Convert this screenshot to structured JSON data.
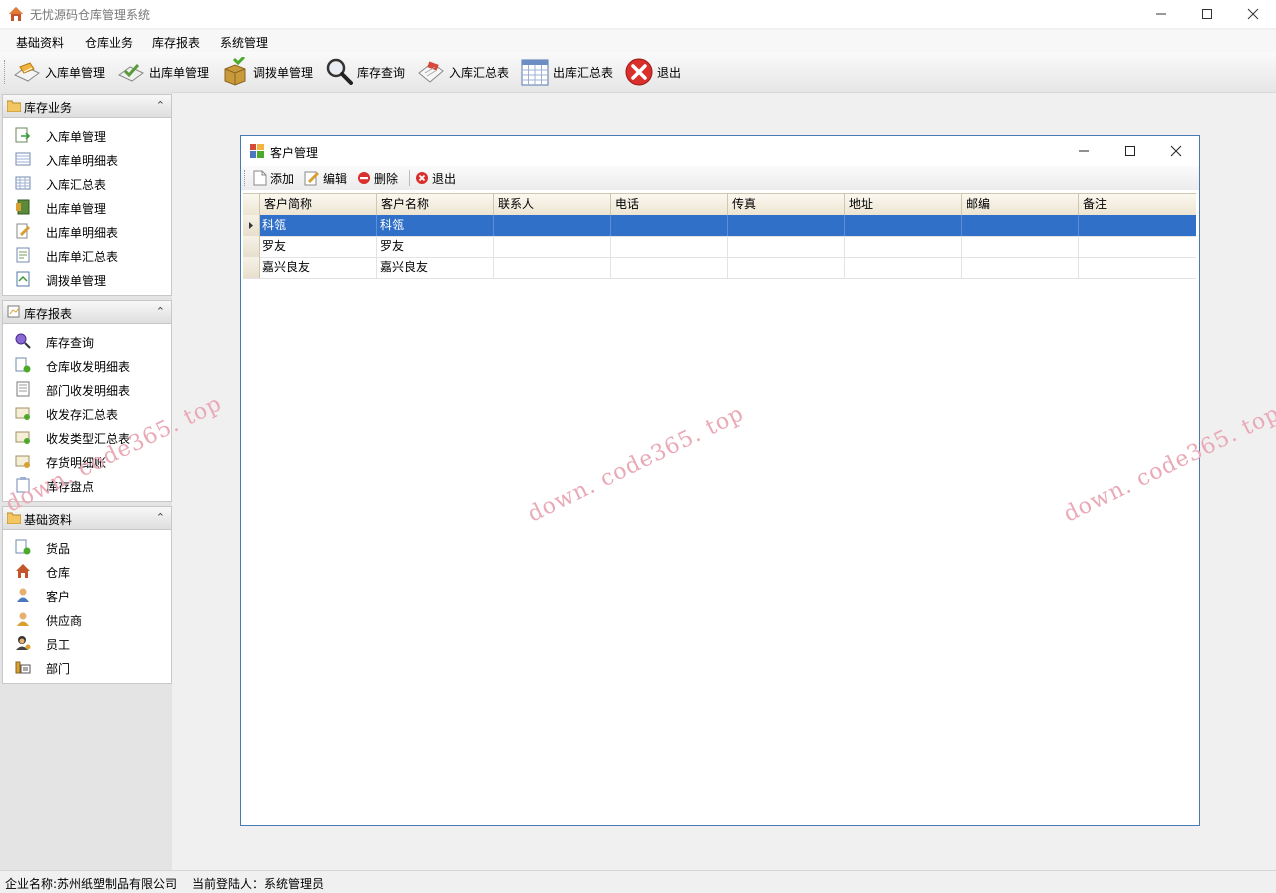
{
  "app": {
    "title": "无忧源码仓库管理系统",
    "icon": "house-icon"
  },
  "menu": [
    "基础资料",
    "仓库业务",
    "库存报表",
    "系统管理"
  ],
  "toolbar": [
    {
      "label": "入库单管理",
      "icon": "stock-in-icon"
    },
    {
      "label": "出库单管理",
      "icon": "stock-out-icon"
    },
    {
      "label": "调拨单管理",
      "icon": "transfer-icon"
    },
    {
      "label": "库存查询",
      "icon": "magnifier-icon"
    },
    {
      "label": "入库汇总表",
      "icon": "calendar-icon"
    },
    {
      "label": "出库汇总表",
      "icon": "grid-table-icon"
    },
    {
      "label": "退出",
      "icon": "close-red-icon"
    }
  ],
  "nav": {
    "panels": [
      {
        "title": "库存业务",
        "items": [
          "入库单管理",
          "入库单明细表",
          "入库汇总表",
          "出库单管理",
          "出库单明细表",
          "出库单汇总表",
          "调拨单管理"
        ]
      },
      {
        "title": "库存报表",
        "items": [
          "库存查询",
          "仓库收发明细表",
          "部门收发明细表",
          "收发存汇总表",
          "收发类型汇总表",
          "存货明细账",
          "库存盘点"
        ]
      },
      {
        "title": "基础资料",
        "items": [
          "货品",
          "仓库",
          "客户",
          "供应商",
          "员工",
          "部门"
        ]
      }
    ]
  },
  "child_window": {
    "title": "客户管理",
    "toolbar": [
      "添加",
      "编辑",
      "删除",
      "退出"
    ],
    "columns": [
      "客户简称",
      "客户名称",
      "联系人",
      "电话",
      "传真",
      "地址",
      "邮编",
      "备注"
    ],
    "rows": [
      [
        "科瓴",
        "科瓴",
        "",
        "",
        "",
        "",
        "",
        ""
      ],
      [
        "罗友",
        "罗友",
        "",
        "",
        "",
        "",
        "",
        ""
      ],
      [
        "嘉兴良友",
        "嘉兴良友",
        "",
        "",
        "",
        "",
        "",
        ""
      ]
    ],
    "selected_row": 0
  },
  "watermark": "down. code365. top",
  "status": {
    "company": "企业名称:苏州纸塑制品有限公司",
    "user": "当前登陆人：系统管理员"
  },
  "colors": {
    "selection": "#3170c8",
    "window_border": "#4a7ab5",
    "watermark": "#e9a9b6",
    "exit_red": "#d9302c"
  }
}
